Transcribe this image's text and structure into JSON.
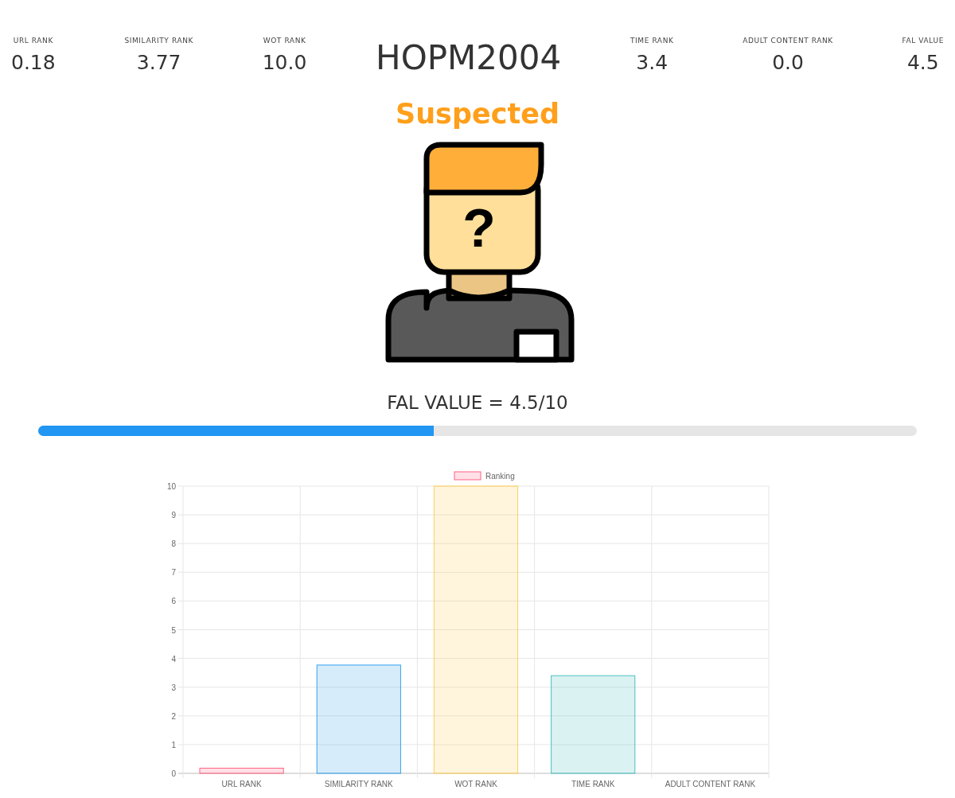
{
  "stats_left": [
    {
      "label": "URL RANK",
      "value": "0.18"
    },
    {
      "label": "SIMILARITY RANK",
      "value": "3.77"
    },
    {
      "label": "WOT RANK",
      "value": "10.0"
    }
  ],
  "title": "HOPM2004",
  "stats_right": [
    {
      "label": "TIME RANK",
      "value": "3.4"
    },
    {
      "label": "ADULT CONTENT RANK",
      "value": "0.0"
    },
    {
      "label": "FAL VALUE",
      "value": "4.5"
    }
  ],
  "status": {
    "text": "Suspected",
    "color": "#ff9f1a"
  },
  "avatar": {
    "mark": "?"
  },
  "fal": {
    "heading": "FAL VALUE = 4.5/10",
    "level": 0.45
  },
  "chart": {
    "chart_data": {
      "type": "bar",
      "categories": [
        "URL RANK",
        "SIMILARITY RANK",
        "WOT RANK",
        "TIME RANK",
        "ADULT CONTENT RANK"
      ],
      "series": [
        {
          "name": "Ranking",
          "values": [
            0.18,
            3.77,
            10,
            3.4,
            0
          ]
        }
      ],
      "grid": true,
      "ylim": [
        0,
        10
      ],
      "yticks": [
        0,
        1,
        2,
        3,
        4,
        5,
        6,
        7,
        8,
        9,
        10
      ]
    }
  }
}
